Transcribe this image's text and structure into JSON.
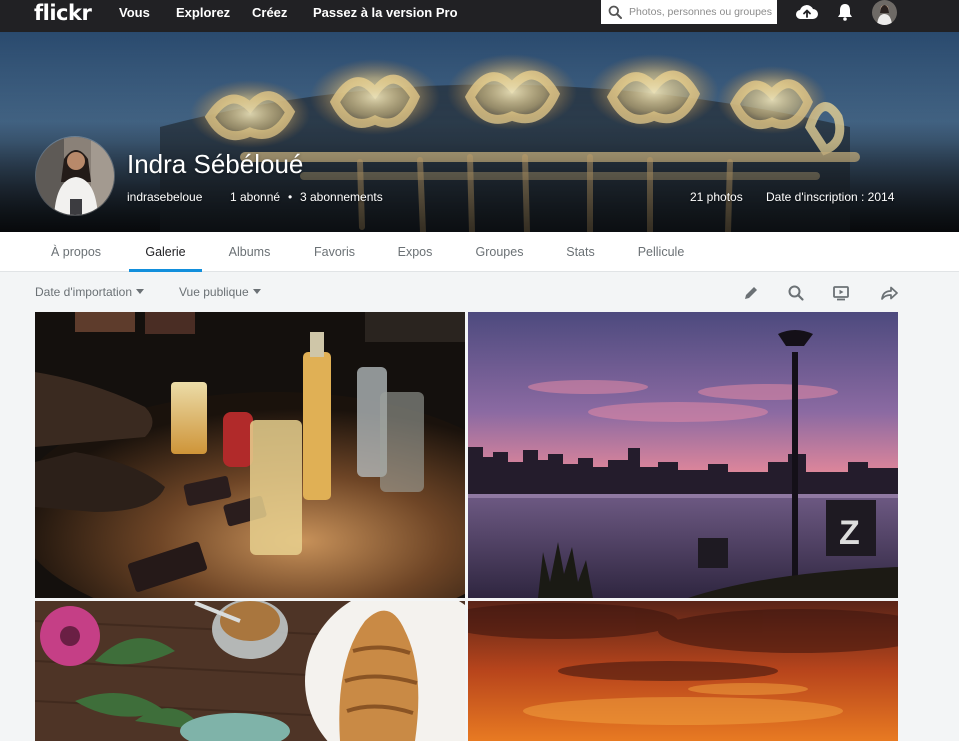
{
  "nav": {
    "logo": "flickr",
    "links": [
      "Vous",
      "Explorez",
      "Créez",
      "Passez à la version Pro"
    ],
    "search_placeholder": "Photos, personnes ou groupes",
    "icons": [
      "search-icon",
      "upload-cloud-icon",
      "notifications-bell-icon"
    ]
  },
  "profile": {
    "name": "Indra Sébéloué",
    "username": "indrasebeloue",
    "followers": "1 abonné",
    "following": "3 abonnements",
    "separator": "•",
    "photos": "21 photos",
    "joined": "Date d'inscription : 2014"
  },
  "tabs": [
    "À propos",
    "Galerie",
    "Albums",
    "Favoris",
    "Expos",
    "Groupes",
    "Stats",
    "Pellicule"
  ],
  "active_tab": "Galerie",
  "toolbar": {
    "sort_label": "Date d'importation",
    "view_label": "Vue publique",
    "icons": [
      "edit-pencil-icon",
      "search-icon",
      "slideshow-icon",
      "share-icon"
    ]
  },
  "colors": {
    "topbar": "#212124",
    "accent": "#128fdc",
    "page_bg": "#f3f5f6"
  }
}
